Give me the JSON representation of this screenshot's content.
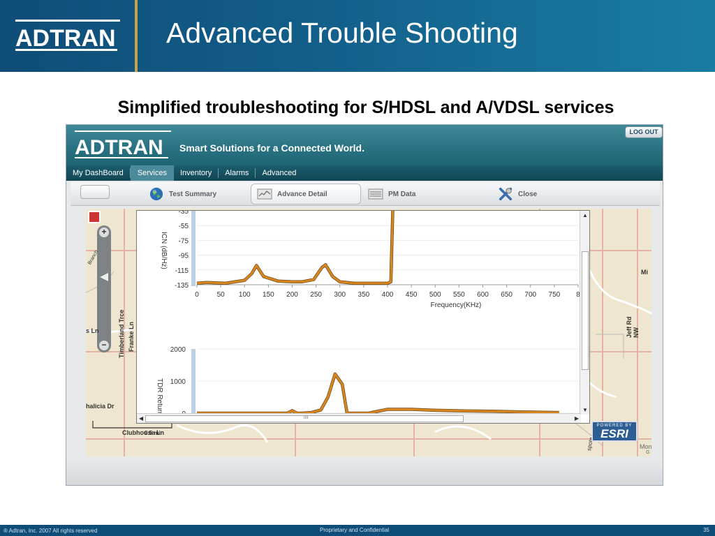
{
  "slide": {
    "title": "Advanced Trouble Shooting",
    "subtitle": "Simplified troubleshooting for S/HDSL and A/VDSL services",
    "logo_text": "ADTRAN",
    "footer_left": "® Adtran, Inc. 2007 All rights reserved",
    "footer_center": "Proprietary and Confidential",
    "page_number": "35"
  },
  "app": {
    "logo_text": "ADTRAN",
    "tagline": "Smart Solutions for a Connected World.",
    "logout_label": "LOG OUT",
    "nav": [
      "My DashBoard",
      "Services",
      "Inventory",
      "Alarms",
      "Advanced"
    ],
    "nav_active_index": 1,
    "toolbar": {
      "test_summary": "Test Summary",
      "advance_detail": "Advance Detail",
      "pm_data": "PM Data",
      "close": "Close"
    },
    "map": {
      "scale_label": "0.5 mi",
      "street_labels": [
        "Timberland Trce",
        "Franke Ln",
        "halicia Dr",
        "Clubhouse Ln",
        "Jeff Rd NW",
        "Mi",
        "s Ln",
        "Branch",
        "Mon",
        "G",
        "spote"
      ],
      "powered_by": "POWERED BY",
      "esri": "ESRI"
    },
    "scroll": {
      "h_grip": "IIII"
    }
  },
  "chart_data": [
    {
      "type": "line",
      "ylabel": "ICN (dB/Hz)",
      "xlabel": "Frequency(KHz)",
      "xticks": [
        0,
        50,
        100,
        150,
        200,
        250,
        300,
        350,
        400,
        450,
        500,
        550,
        600,
        650,
        700,
        750,
        "8"
      ],
      "yticks": [
        -35,
        -55,
        -75,
        -95,
        -115,
        -135
      ],
      "ylim": [
        -135,
        -35
      ],
      "xlim": [
        0,
        800
      ],
      "color": "#d9861f",
      "x": [
        0,
        20,
        60,
        100,
        115,
        125,
        140,
        170,
        200,
        220,
        245,
        262,
        270,
        285,
        300,
        330,
        360,
        400,
        407,
        411
      ],
      "values": [
        -133,
        -132,
        -133,
        -129,
        -120,
        -109,
        -124,
        -130,
        -131,
        -131,
        -128,
        -112,
        -108,
        -124,
        -131,
        -133,
        -133,
        -133,
        -131,
        -35
      ]
    },
    {
      "type": "line",
      "ylabel": "TDR Return",
      "yticks": [
        2000,
        1000,
        0
      ],
      "ylim": [
        0,
        2000
      ],
      "xlim": [
        0,
        800
      ],
      "color": "#d9861f",
      "x": [
        0,
        80,
        160,
        190,
        200,
        210,
        220,
        240,
        260,
        275,
        290,
        305,
        315,
        335,
        360,
        400,
        450,
        500,
        560,
        620,
        680,
        760
      ],
      "values": [
        0,
        0,
        0,
        0,
        80,
        0,
        0,
        20,
        100,
        500,
        1220,
        900,
        0,
        0,
        0,
        120,
        120,
        90,
        70,
        60,
        40,
        20
      ]
    }
  ]
}
